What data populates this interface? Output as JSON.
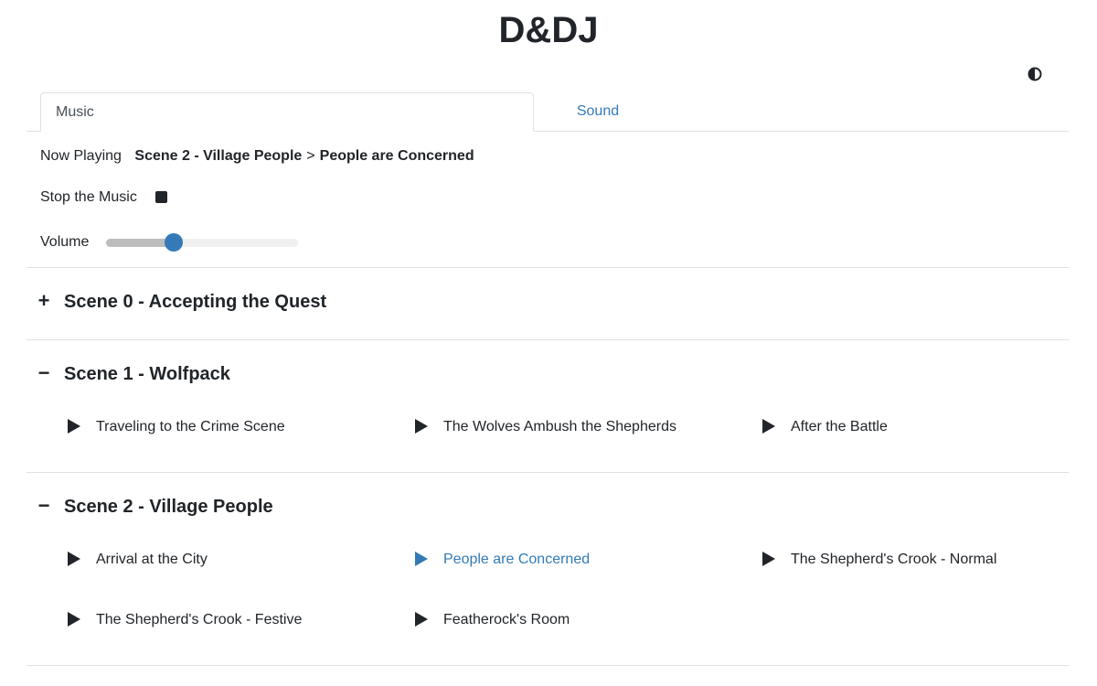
{
  "app": {
    "title": "D&DJ"
  },
  "theme_toggle": {
    "icon": "half-circle-contrast-icon"
  },
  "tabs": [
    {
      "label": "Music",
      "active": true
    },
    {
      "label": "Sound",
      "active": false
    }
  ],
  "player": {
    "now_playing_label": "Now Playing",
    "scene": "Scene 2 - Village People",
    "separator": ">",
    "track": "People are Concerned",
    "stop_label": "Stop the Music",
    "volume_label": "Volume",
    "volume_percent": 35
  },
  "scenes": [
    {
      "title": "Scene 0 - Accepting the Quest",
      "toggle": "+",
      "expanded": false,
      "tracks": []
    },
    {
      "title": "Scene 1 - Wolfpack",
      "toggle": "−",
      "expanded": true,
      "tracks": [
        "Traveling to the Crime Scene",
        "The Wolves Ambush the Shepherds",
        "After the Battle"
      ]
    },
    {
      "title": "Scene 2 - Village People",
      "toggle": "−",
      "expanded": true,
      "tracks": [
        "Arrival at the City",
        "People are Concerned",
        "The Shepherd's Crook - Normal",
        "The Shepherd's Crook - Festive",
        "Featherock's Room"
      ]
    }
  ],
  "colors": {
    "accent": "#337ab7",
    "text": "#212529",
    "divider": "#dee2e6"
  }
}
